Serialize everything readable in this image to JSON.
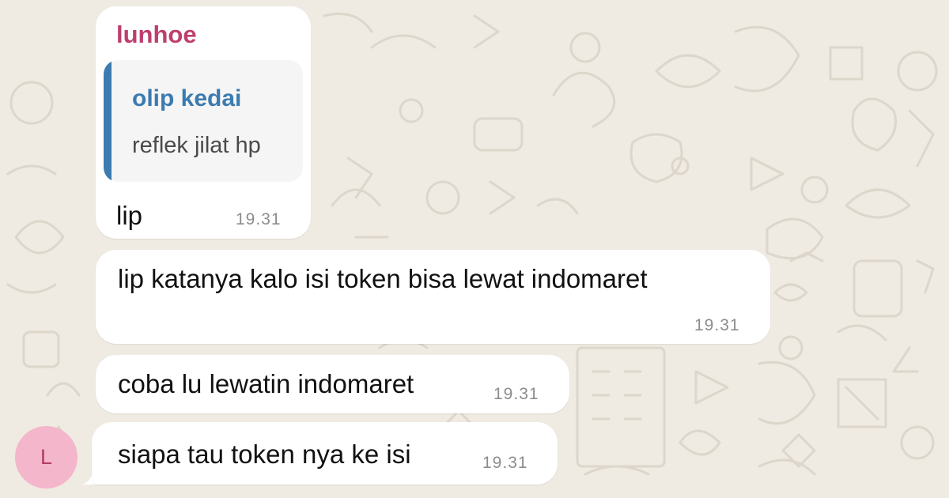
{
  "theme": {
    "wallpaper_color": "#efeae2",
    "bubble_color": "#ffffff",
    "sender_name_color": "#bd3f6e",
    "quote_accent_color": "#3b7bb0",
    "avatar_bg": "#f3b6cb"
  },
  "messages": [
    {
      "sender": "lunhoe",
      "quoted": {
        "author": "olip kedai",
        "text": "reflek jilat hp"
      },
      "text": "lip",
      "time": "19.31"
    },
    {
      "text": "lip katanya kalo isi token bisa lewat indomaret",
      "time": "19.31"
    },
    {
      "text": "coba lu lewatin indomaret",
      "time": "19.31"
    },
    {
      "text": "siapa tau token nya ke isi",
      "time": "19.31"
    }
  ],
  "avatar": {
    "initial": "L"
  }
}
